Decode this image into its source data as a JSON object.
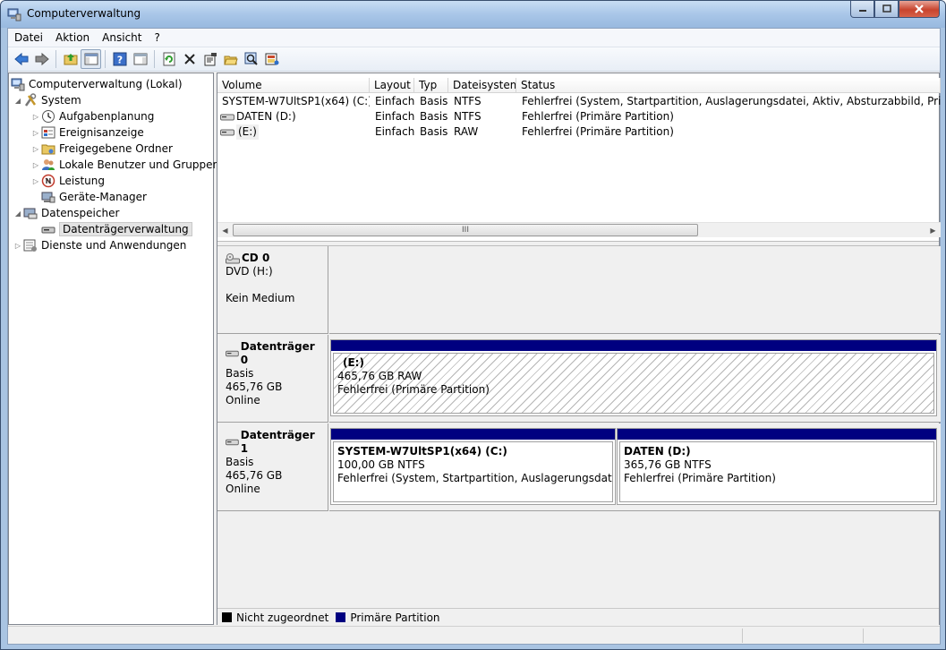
{
  "window": {
    "title": "Computerverwaltung"
  },
  "menu": [
    "Datei",
    "Aktion",
    "Ansicht",
    "?"
  ],
  "toolbar": {
    "buttons": [
      "back-icon",
      "forward-icon",
      "up-folder-icon",
      "show-hide-tree-icon",
      "help-icon",
      "console-icon",
      "refresh-icon",
      "delete-icon",
      "properties-icon",
      "open-icon",
      "search-disk-icon",
      "export-icon"
    ]
  },
  "tree": {
    "root": "Computerverwaltung (Lokal)",
    "system": "System",
    "aufgaben": "Aufgabenplanung",
    "ereignis": "Ereignisanzeige",
    "freigabe": "Freigegebene Ordner",
    "benutzer": "Lokale Benutzer und Gruppen",
    "leistung": "Leistung",
    "geraete": "Geräte-Manager",
    "datenspeicher": "Datenspeicher",
    "datentraeger": "Datenträgerverwaltung",
    "dienste": "Dienste und Anwendungen"
  },
  "columns": [
    "Volume",
    "Layout",
    "Typ",
    "Dateisystem",
    "Status"
  ],
  "volumes": [
    {
      "volume": "SYSTEM-W7UltSP1(x64) (C:)",
      "layout": "Einfach",
      "typ": "Basis",
      "fs": "NTFS",
      "status": "Fehlerfrei (System, Startpartition, Auslagerungsdatei, Aktiv, Absturzabbild, Primäre Partition)"
    },
    {
      "volume": "DATEN (D:)",
      "layout": "Einfach",
      "typ": "Basis",
      "fs": "NTFS",
      "status": "Fehlerfrei (Primäre Partition)"
    },
    {
      "volume": "(E:)",
      "layout": "Einfach",
      "typ": "Basis",
      "fs": "RAW",
      "status": "Fehlerfrei (Primäre Partition)"
    }
  ],
  "scrollbar": {
    "thumb_grip": "III"
  },
  "disks": {
    "cd0": {
      "name": "CD 0",
      "line1": "DVD (H:)",
      "line2": "Kein Medium"
    },
    "d0": {
      "name": "Datenträger 0",
      "line1": "Basis",
      "line2": "465,76 GB",
      "line3": "Online",
      "part": {
        "name": "(E:)",
        "size": "465,76 GB RAW",
        "status": "Fehlerfrei (Primäre Partition)"
      }
    },
    "d1": {
      "name": "Datenträger 1",
      "line1": "Basis",
      "line2": "465,76 GB",
      "line3": "Online",
      "partC": {
        "name": "SYSTEM-W7UltSP1(x64)  (C:)",
        "size": "100,00 GB NTFS",
        "status": "Fehlerfrei (System, Startpartition, Auslagerungsdatei, Aktiv"
      },
      "partD": {
        "name": "DATEN  (D:)",
        "size": "365,76 GB NTFS",
        "status": "Fehlerfrei (Primäre Partition)"
      }
    }
  },
  "legend": [
    {
      "label": "Nicht zugeordnet",
      "color": "#000000"
    },
    {
      "label": "Primäre Partition",
      "color": "#000080"
    }
  ],
  "colors": {
    "partition_bar": "#000080",
    "titlebar": "#a9c6e8"
  }
}
